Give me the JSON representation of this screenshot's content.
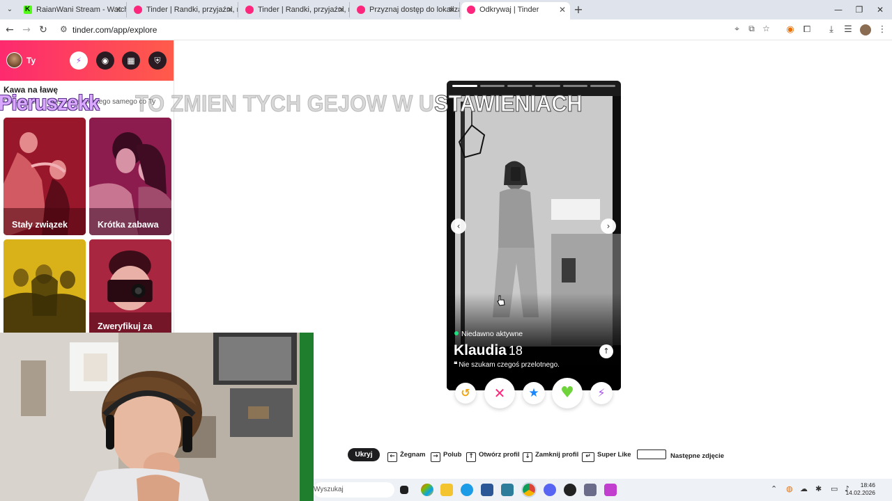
{
  "browser": {
    "tabs": [
      {
        "title": "RaianWani Stream - Watch Live",
        "favicon": "kick-icon"
      },
      {
        "title": "Tinder | Randki, przyjaźni, nowe",
        "favicon": "tinder-icon"
      },
      {
        "title": "Tinder | Randki, przyjaźni, nowe",
        "favicon": "tinder-icon"
      },
      {
        "title": "Przyznaj dostęp do lokalizacji u",
        "favicon": "tinder-icon"
      },
      {
        "title": "Odkrywaj | Tinder",
        "favicon": "tinder-icon",
        "active": true
      }
    ],
    "url": "tinder.com/app/explore"
  },
  "sidebar": {
    "user_label": "Ty",
    "section_title": "Kawa na ławę",
    "section_desc": "Dopasuj się z kimś, kto szuka tego samego co Ty",
    "cards": [
      {
        "label": "Stały związek",
        "color": "#9b1530"
      },
      {
        "label": "Krótka zabawa",
        "color": "#7a1844"
      },
      {
        "label": "",
        "color": "#d6ac18"
      },
      {
        "label": "Zweryfikuj za",
        "color": "#9b1f3a"
      }
    ]
  },
  "overlay": {
    "name": "Pieruszekk",
    "message_dim": "TO ZMIEN TYCH GEJOW W U",
    "message_bright": "STAWIENIACH"
  },
  "profile": {
    "status": "Niedawno aktywne",
    "name": "Klaudia",
    "age": "18",
    "bio": "Nie szukam czegoś przelotnego.",
    "photo_count": 6,
    "photo_index": 0
  },
  "actions": {
    "rewind": "↺",
    "nope": "✕",
    "superlike": "★",
    "like": "♥",
    "boost": "⚡"
  },
  "shortcuts": {
    "hide": "Ukryj",
    "items": [
      {
        "key": "←",
        "label": "Żegnam"
      },
      {
        "key": "→",
        "label": "Polub"
      },
      {
        "key": "↑",
        "label": "Otwórz profil"
      },
      {
        "key": "↓",
        "label": "Zamknij profil"
      },
      {
        "key": "↵",
        "label": "Super Like"
      },
      {
        "key": "",
        "label": "Następne zdjęcie"
      }
    ]
  },
  "taskbar": {
    "search_placeholder": "Wyszukaj",
    "time": "18:46",
    "date": "14.02.2026"
  }
}
